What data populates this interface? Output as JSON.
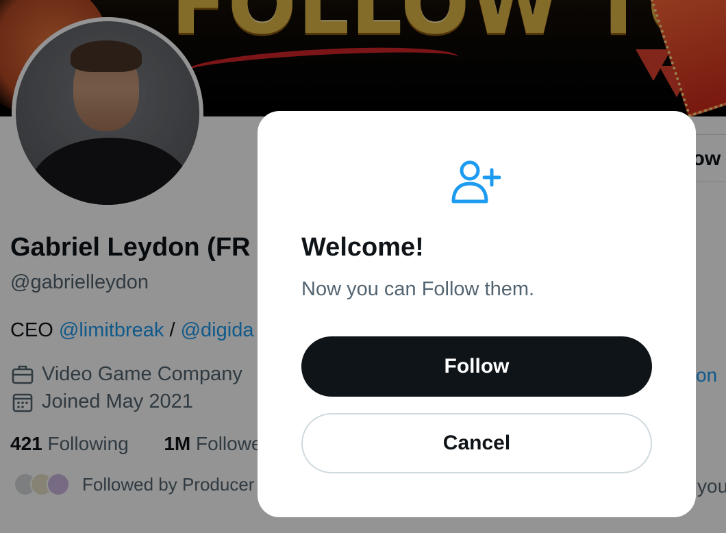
{
  "banner": {
    "text": "FOLLOW TO WIN"
  },
  "profile": {
    "name": "Gabriel Leydon (FR",
    "handle": "@gabrielleydon",
    "bio": {
      "prefix": "CEO ",
      "link1": "@limitbreak",
      "sep": " / ",
      "link2": "@digida"
    },
    "category": "Video Game Company",
    "joined": "Joined May 2021",
    "following_count": "421",
    "following_label": "Following",
    "followers_count": "1M",
    "followers_label": "Followe",
    "followed_by": "Followed by Producer ("
  },
  "right_edge": {
    "follow_button_label": "llow",
    "link_fragment": "on",
    "you_fragment": "you"
  },
  "modal": {
    "icon": "person-add-icon",
    "title": "Welcome!",
    "subtitle": "Now you can Follow them.",
    "follow_label": "Follow",
    "cancel_label": "Cancel"
  },
  "colors": {
    "accent": "#1d9bf0",
    "primary_text": "#0f1419",
    "secondary_text": "#536471",
    "button_dark": "#0f1419",
    "border": "#cfd9de"
  }
}
